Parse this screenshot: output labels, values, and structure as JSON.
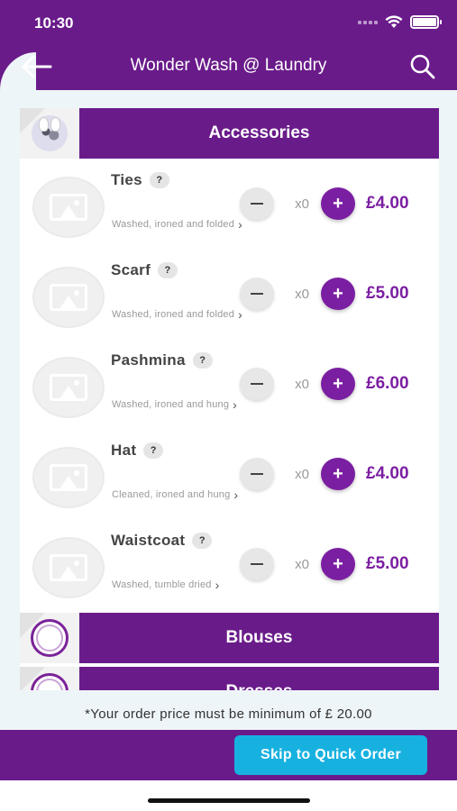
{
  "status_bar": {
    "time": "10:30"
  },
  "nav": {
    "title": "Wonder Wash @ Laundry",
    "back_icon": "arrow-left-icon",
    "search_icon": "search-icon"
  },
  "categories": [
    {
      "label": "Accessories",
      "icon": "category-photo-icon"
    },
    {
      "label": "Blouses",
      "icon": "box-icon"
    },
    {
      "label": "Dresses",
      "icon": "box-icon"
    }
  ],
  "help_label": "?",
  "items": [
    {
      "name": "Ties",
      "description": "Washed, ironed and folded",
      "quantity": "x0",
      "price": "£4.00"
    },
    {
      "name": "Scarf",
      "description": "Washed, ironed and folded",
      "quantity": "x0",
      "price": "£5.00"
    },
    {
      "name": "Pashmina",
      "description": "Washed, ironed and hung",
      "quantity": "x0",
      "price": "£6.00"
    },
    {
      "name": "Hat",
      "description": "Cleaned, ironed and hung",
      "quantity": "x0",
      "price": "£4.00"
    },
    {
      "name": "Waistcoat",
      "description": "Washed, tumble dried",
      "quantity": "x0",
      "price": "£5.00"
    }
  ],
  "min_order_note": "*Your order price must be minimum of £ 20.00",
  "footer": {
    "quick_order_label": "Skip to Quick Order"
  },
  "colors": {
    "primary": "#6a1b8a",
    "accent": "#7b1fa2",
    "button": "#17b1e0",
    "background": "#eef5f8"
  }
}
